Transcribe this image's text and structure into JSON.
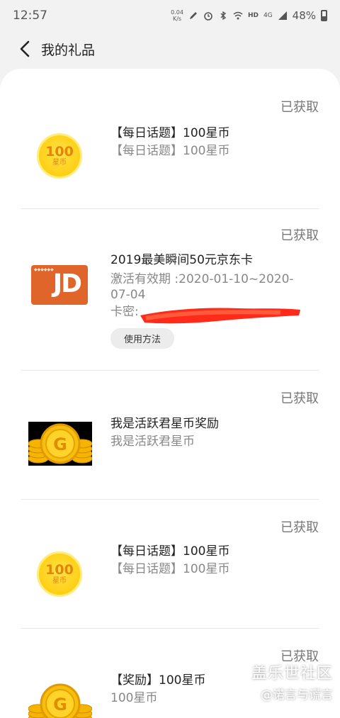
{
  "status_bar": {
    "time": "12:57",
    "net_speed_value": "0.04",
    "net_speed_unit": "K/s",
    "network_label": "HD",
    "signal_label": "4G",
    "battery": "48%"
  },
  "header": {
    "title": "我的礼品"
  },
  "gifts": [
    {
      "status": "已获取",
      "title": "【每日话题】100星币",
      "subtitle": "【每日话题】100星币",
      "icon": {
        "type": "coin-100",
        "number": "100",
        "label": "星币"
      }
    },
    {
      "status": "已获取",
      "title": "2019最美瞬间50元京东卡",
      "validity": "激活有效期 :2020-01-10~2020-07-04",
      "card_secret_label": "卡密:",
      "action_label": "使用方法",
      "icon": {
        "type": "jd-card",
        "brand_text": "JD"
      }
    },
    {
      "status": "已获取",
      "title": "我是活跃君星币奖励",
      "subtitle": "我是活跃君星币",
      "icon": {
        "type": "gold-coin-stack",
        "letter": "G"
      }
    },
    {
      "status": "已获取",
      "title": "【每日话题】100星币",
      "subtitle": "【每日话题】100星币",
      "icon": {
        "type": "coin-100",
        "number": "100",
        "label": "星币"
      }
    },
    {
      "status": "已获取",
      "title": "【奖励】100星币",
      "subtitle": "100星币",
      "icon": {
        "type": "gold-coin-stack",
        "letter": "G"
      }
    }
  ],
  "watermark": {
    "line1": "盖乐世社区",
    "line2": "@诺言与谎言"
  },
  "colors": {
    "accent_coin": "#ffd21c",
    "jd_orange": "#e0652a",
    "redaction": "#ff2a1a"
  }
}
